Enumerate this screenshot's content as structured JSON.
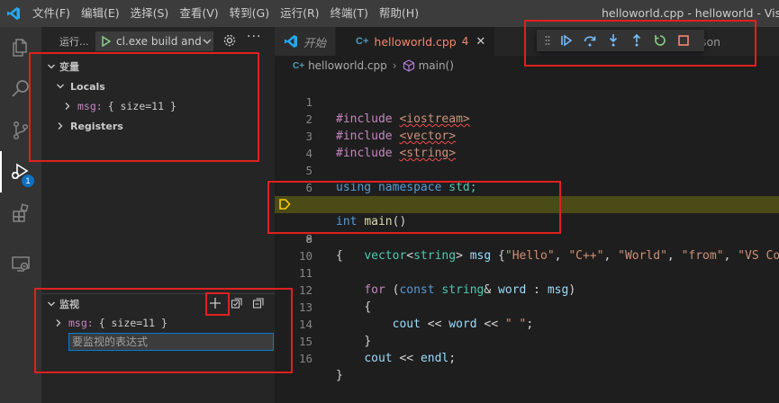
{
  "menu": [
    "文件(F)",
    "编辑(E)",
    "选择(S)",
    "查看(V)",
    "转到(G)",
    "运行(R)",
    "终端(T)",
    "帮助(H)"
  ],
  "window_title": "helloworld.cpp - helloworld - Visual Studio Code",
  "activity": {
    "debug_badge": "1"
  },
  "run": {
    "label": "运行...",
    "config": "cl.exe build and debug active file"
  },
  "variables": {
    "title": "变量",
    "locals_label": "Locals",
    "msg_name": "msg:",
    "msg_value": "{ size=11 }",
    "registers_label": "Registers"
  },
  "watch": {
    "title": "监视",
    "msg_name": "msg:",
    "msg_value": "{ size=11 }",
    "input_placeholder": "要监视的表达式"
  },
  "tabs": [
    {
      "label": "开始"
    },
    {
      "label": "helloworld.cpp",
      "problems": "4"
    }
  ],
  "tab_overflow": "son",
  "breadcrumb": {
    "file": "helloworld.cpp",
    "symbol": "main()"
  },
  "editor": {
    "current_line": 8,
    "lines": [
      {
        "n": "1"
      },
      {
        "n": "2"
      },
      {
        "n": "3"
      },
      {
        "n": "4"
      },
      {
        "n": "5"
      },
      {
        "n": "6"
      },
      {
        "n": "7"
      },
      {
        "n": "8"
      },
      {
        "n": "9"
      },
      {
        "n": "10"
      },
      {
        "n": "11"
      },
      {
        "n": "12"
      },
      {
        "n": "13"
      },
      {
        "n": "14"
      },
      {
        "n": "15"
      },
      {
        "n": "16"
      }
    ],
    "tokens": {
      "include": "#include",
      "iostream": "<iostream>",
      "vector_h": "<vector>",
      "string_h": "<string>",
      "using": "using",
      "namespace": "namespace",
      "std": "std;",
      "int": "int",
      "main": "main",
      "parens": "()",
      "lbrace": "{",
      "rbrace": "}",
      "vector": "vector",
      "lt": "<",
      "string": "string",
      "gt": ">",
      "msg": "msg",
      "init_open": " {",
      "s_hello": "\"Hello\"",
      "s_cpp": "\"C++\"",
      "s_world": "\"World\"",
      "s_from": "\"from\"",
      "s_vscode": "\"VS Code",
      "comma": ", ",
      "for": "for",
      "const": "const",
      "amp": "&",
      "word": "word",
      "colon": " : ",
      "cout": "cout",
      "shl": " << ",
      "space_str": "\" \"",
      "semi": ";",
      "endl": "endl",
      "lparen": " (",
      "rparen": ")"
    }
  }
}
